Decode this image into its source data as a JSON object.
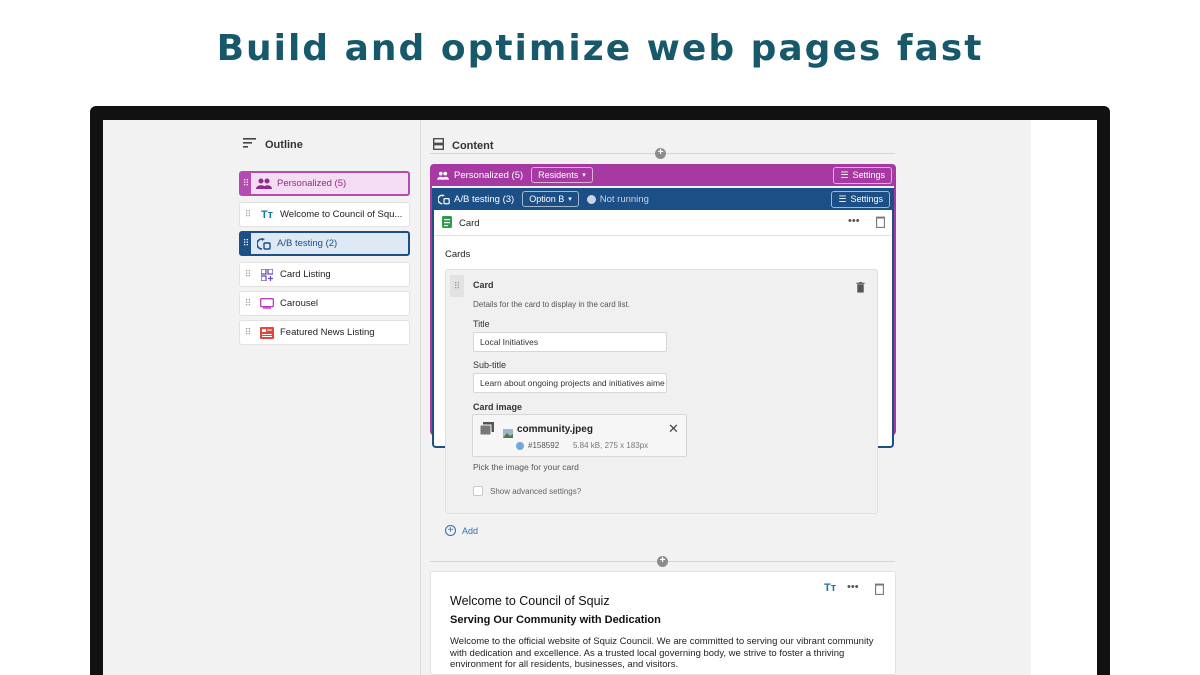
{
  "headline": "Build and optimize web pages fast",
  "outline": {
    "title": "Outline",
    "items": [
      {
        "label": "Personalized (5)"
      },
      {
        "label": "Welcome to Council of Squ..."
      },
      {
        "label": "A/B testing (2)"
      },
      {
        "label": "Card Listing"
      },
      {
        "label": "Carousel"
      },
      {
        "label": "Featured News Listing"
      }
    ]
  },
  "content": {
    "title": "Content",
    "personalized": {
      "label": "Personalized (5)",
      "segment": "Residents",
      "settings": "Settings"
    },
    "ab_testing": {
      "label": "A/B testing (3)",
      "option": "Option B",
      "status": "Not running",
      "settings": "Settings"
    },
    "card_block": {
      "title": "Card",
      "section": "Cards",
      "card": {
        "title": "Card",
        "description": "Details for the card to display in the card list.",
        "title_label": "Title",
        "title_value": "Local Initiatives",
        "subtitle_label": "Sub-title",
        "subtitle_value": "Learn about ongoing projects and initiatives aime",
        "image_label": "Card image",
        "file_name": "community.jpeg",
        "file_id": "#158592",
        "file_meta": "5.84 kB, 275 x 183px",
        "image_hint": "Pick the image for your card",
        "advanced": "Show advanced settings?"
      },
      "add_label": "Add"
    },
    "welcome_block": {
      "heading": "Welcome to Council of Squiz",
      "subheading": "Serving Our Community with Dedication",
      "body": "Welcome to the official website of Squiz Council. We are committed to serving our vibrant community with dedication and excellence. As a trusted local governing body, we strive to foster a thriving environment for all residents, businesses, and visitors."
    }
  },
  "colors": {
    "headline": "#17596b",
    "personalized": "#a63aa2",
    "ab_testing": "#1b4f86",
    "link": "#2a6fb8"
  }
}
